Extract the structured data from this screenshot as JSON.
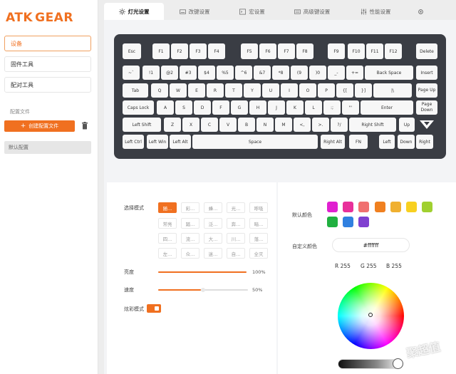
{
  "brand": {
    "logo_a": "ATK",
    "logo_b": "GEAR"
  },
  "sidebar": {
    "items": [
      {
        "label": "设备",
        "active": true
      },
      {
        "label": "固件工具",
        "active": false
      },
      {
        "label": "配对工具",
        "active": false
      }
    ],
    "profiles_label": "配置文件",
    "new_profile_label": "创建配置文件",
    "default_profile": "默认配置"
  },
  "tabs": [
    {
      "label": "灯光设置",
      "icon": "sun-icon",
      "active": true
    },
    {
      "label": "改键设置",
      "icon": "keyboard-icon",
      "active": false
    },
    {
      "label": "宏设置",
      "icon": "macro-icon",
      "active": false
    },
    {
      "label": "高级键设置",
      "icon": "advanced-key-icon",
      "active": false
    },
    {
      "label": "性能设置",
      "icon": "sliders-icon",
      "active": false
    },
    {
      "label": "",
      "icon": "settings-gear-icon",
      "active": false
    }
  ],
  "keyboard": {
    "rows": [
      [
        "Esc",
        "F1",
        "F2",
        "F3",
        "F4",
        "F5",
        "F6",
        "F7",
        "F8",
        "F9",
        "F10",
        "F11",
        "F12",
        "Delete"
      ],
      [
        "~`",
        "!1",
        "@2",
        "#3",
        "$4",
        "%5",
        "^6",
        "&7",
        "*8",
        "(9",
        ")0",
        "_-",
        "+=",
        "Back Space",
        "Insert"
      ],
      [
        "Tab",
        "Q",
        "W",
        "E",
        "R",
        "T",
        "Y",
        "U",
        "I",
        "O",
        "P",
        "{[",
        "}]",
        "|\\",
        "Page Up"
      ],
      [
        "Caps Lock",
        "A",
        "S",
        "D",
        "F",
        "G",
        "H",
        "J",
        "K",
        "L",
        ":;",
        "\"'",
        "Enter",
        "Page Down"
      ],
      [
        "Left Shift",
        "Z",
        "X",
        "C",
        "V",
        "B",
        "N",
        "M",
        "<,",
        ">.",
        "?/",
        "Right Shift",
        "Up"
      ],
      [
        "Left Ctrl",
        "Left Win",
        "Left Alt",
        "Space",
        "Right Alt",
        "FN",
        "Left",
        "Down",
        "Right"
      ]
    ]
  },
  "lighting": {
    "mode_label": "选择模式",
    "modes": [
      [
        "随...",
        "彩...",
        "蜂...",
        "光...",
        "呼吸"
      ],
      [
        "常亮",
        "踏...",
        "泛...",
        "奔...",
        "暗..."
      ],
      [
        "四...",
        "流...",
        "大...",
        "川...",
        "落..."
      ],
      [
        "左...",
        "众...",
        "迷...",
        "自...",
        "全灭"
      ]
    ],
    "brightness_label": "亮度",
    "brightness_value": "100%",
    "brightness_fraction": 1.0,
    "speed_label": "速度",
    "speed_value": "50%",
    "speed_fraction": 0.5,
    "dazzle_label": "炫彩模式",
    "dazzle_on": true
  },
  "color": {
    "default_label": "默认颜色",
    "swatches": [
      "#e020d0",
      "#e8309a",
      "#f07070",
      "#f08020",
      "#f0b030",
      "#f8d020",
      "#a0d030",
      "#20b040",
      "#3080e0",
      "#8040d0"
    ],
    "custom_label": "自定义颜色",
    "hex": "#ffffff",
    "r_label": "R",
    "r": "255",
    "g_label": "G",
    "g": "255",
    "b_label": "B",
    "b": "255"
  },
  "watermark": "聚超值"
}
